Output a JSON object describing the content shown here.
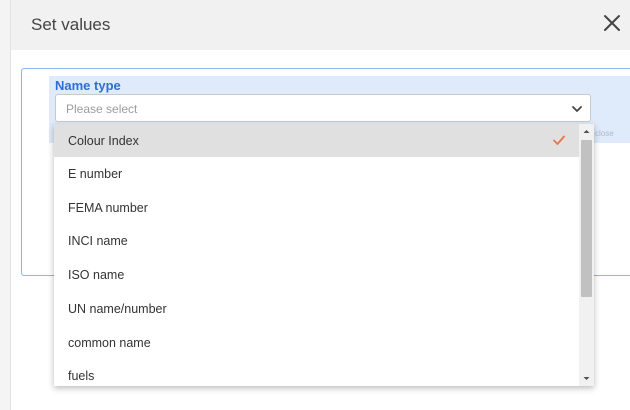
{
  "dialog": {
    "title": "Set values"
  },
  "field": {
    "label": "Name type",
    "placeholder": "Please select",
    "close_hint": "close"
  },
  "dropdown": {
    "options": [
      {
        "label": "Colour Index",
        "selected": true
      },
      {
        "label": "E number",
        "selected": false
      },
      {
        "label": "FEMA number",
        "selected": false
      },
      {
        "label": "INCI name",
        "selected": false
      },
      {
        "label": "ISO name",
        "selected": false
      },
      {
        "label": "UN name/number",
        "selected": false
      },
      {
        "label": "common name",
        "selected": false
      },
      {
        "label": "fuels",
        "selected": false
      }
    ]
  },
  "colors": {
    "accent": "#2e6fd0",
    "check": "#e8754a",
    "panel_border": "#8ab4f2",
    "field_bg": "#dfeafb"
  },
  "icons": {
    "close": "close-icon",
    "chevron": "chevron-down-icon",
    "check": "check-icon"
  }
}
